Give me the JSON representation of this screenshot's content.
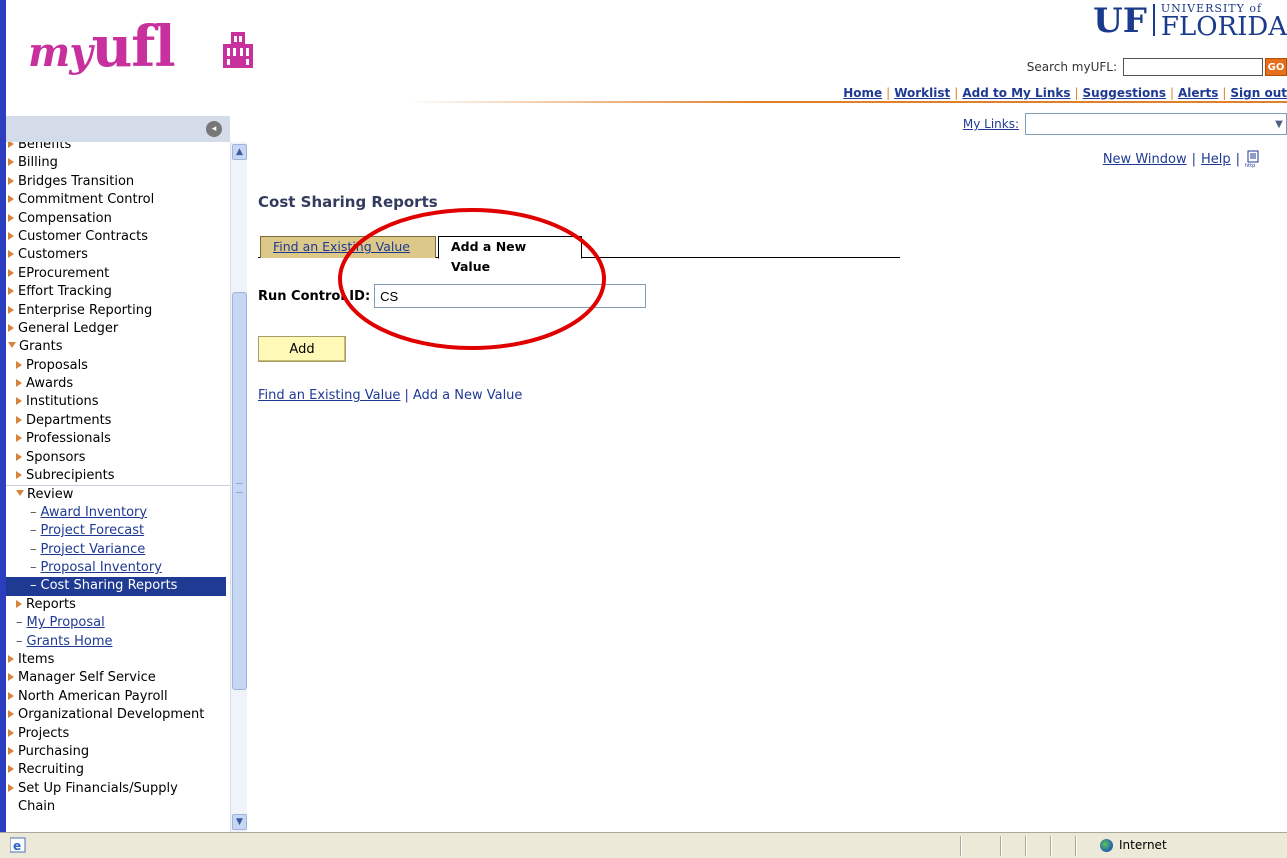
{
  "header": {
    "logo_my": "my",
    "logo_ufl": "ufl",
    "uf_letters": "UF",
    "uf_university": "UNIVERSITY of",
    "uf_florida": "FLORIDA",
    "search_label": "Search myUFL:",
    "search_value": "",
    "go_label": "GO",
    "top_links": [
      "Home",
      "Worklist",
      "Add to My Links",
      "Suggestions",
      "Alerts",
      "Sign out"
    ],
    "mylinks_label": "My Links:",
    "mylinks_value": ""
  },
  "nav": {
    "items": [
      {
        "label": "Benefits",
        "type": "folder",
        "level": 0
      },
      {
        "label": "Billing",
        "type": "folder",
        "level": 0
      },
      {
        "label": "Bridges Transition",
        "type": "folder",
        "level": 0
      },
      {
        "label": "Commitment Control",
        "type": "folder",
        "level": 0
      },
      {
        "label": "Compensation",
        "type": "folder",
        "level": 0
      },
      {
        "label": "Customer Contracts",
        "type": "folder",
        "level": 0
      },
      {
        "label": "Customers",
        "type": "folder",
        "level": 0
      },
      {
        "label": "EProcurement",
        "type": "folder",
        "level": 0
      },
      {
        "label": "Effort Tracking",
        "type": "folder",
        "level": 0
      },
      {
        "label": "Enterprise Reporting",
        "type": "folder",
        "level": 0
      },
      {
        "label": "General Ledger",
        "type": "folder",
        "level": 0
      },
      {
        "label": "Grants",
        "type": "open",
        "level": 0
      },
      {
        "label": "Proposals",
        "type": "folder",
        "level": 1
      },
      {
        "label": "Awards",
        "type": "folder",
        "level": 1
      },
      {
        "label": "Institutions",
        "type": "folder",
        "level": 1
      },
      {
        "label": "Departments",
        "type": "folder",
        "level": 1
      },
      {
        "label": "Professionals",
        "type": "folder",
        "level": 1
      },
      {
        "label": "Sponsors",
        "type": "folder",
        "level": 1
      },
      {
        "label": "Subrecipients",
        "type": "folder",
        "level": 1
      },
      {
        "label": "Review",
        "type": "open",
        "level": 1
      },
      {
        "label": "Award Inventory",
        "type": "link",
        "level": 2
      },
      {
        "label": "Project Forecast",
        "type": "link",
        "level": 2
      },
      {
        "label": "Project Variance",
        "type": "link",
        "level": 2
      },
      {
        "label": "Proposal Inventory",
        "type": "link",
        "level": 2
      },
      {
        "label": "Cost Sharing Reports",
        "type": "selected",
        "level": 2
      },
      {
        "label": "Reports",
        "type": "folder",
        "level": 1
      },
      {
        "label": "My Proposal",
        "type": "link",
        "level": 1
      },
      {
        "label": "Grants Home",
        "type": "link",
        "level": 1
      },
      {
        "label": "Items",
        "type": "folder",
        "level": 0
      },
      {
        "label": "Manager Self Service",
        "type": "folder",
        "level": 0
      },
      {
        "label": "North American Payroll",
        "type": "folder",
        "level": 0
      },
      {
        "label": "Organizational Development",
        "type": "folder",
        "level": 0
      },
      {
        "label": "Projects",
        "type": "folder",
        "level": 0
      },
      {
        "label": "Purchasing",
        "type": "folder",
        "level": 0
      },
      {
        "label": "Recruiting",
        "type": "folder",
        "level": 0
      },
      {
        "label": "Set Up Financials/Supply",
        "type": "folder",
        "level": 0
      },
      {
        "label": "Chain",
        "type": "continuation",
        "level": 0
      }
    ]
  },
  "main": {
    "top_links": [
      "New Window",
      "Help"
    ],
    "page_title": "Cost Sharing Reports",
    "tabs": [
      "Find an Existing Value",
      "Add a New Value"
    ],
    "field_label": "Run Control ID:",
    "field_value": "CS",
    "add_button": "Add",
    "bottom_links": [
      "Find an Existing Value",
      "Add a New Value"
    ]
  },
  "statusbar": {
    "zone": "Internet"
  },
  "colors": {
    "brand_pink": "#c8309e",
    "uf_blue": "#1a3a8c",
    "link_blue": "#1f3a93",
    "accent_orange": "#e0802a",
    "annotation_red": "#e00000",
    "add_button_yellow": "#fff9b8",
    "tab_tan": "#dcc98a"
  },
  "icons": {
    "nav_collapse": "collapse-circle-icon",
    "logo_building": "century-tower-icon",
    "http": "http-page-icon",
    "ie": "ie-icon",
    "globe": "globe-icon"
  }
}
